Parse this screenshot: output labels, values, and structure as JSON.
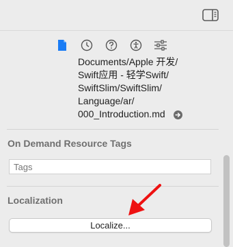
{
  "inspector": {
    "tabs": [
      {
        "icon": "file-icon",
        "active": true
      },
      {
        "icon": "history-clock-icon",
        "active": false
      },
      {
        "icon": "quick-help-icon",
        "active": false
      },
      {
        "icon": "accessibility-icon",
        "active": false
      },
      {
        "icon": "attributes-sliders-icon",
        "active": false
      }
    ],
    "path_lines": [
      "Documents/Apple 开发/",
      "Swift应用 - 轻学Swift/",
      "SwiftSlim/SwiftSlim/",
      "Language/ar/",
      "000_Introduction.md"
    ],
    "on_demand": {
      "title": "On Demand Resource Tags",
      "tags_placeholder": "Tags"
    },
    "localization": {
      "title": "Localization",
      "button_label": "Localize..."
    }
  },
  "colors": {
    "accent": "#1a7cf5",
    "annotation_arrow": "#ee1111",
    "section_title": "#6f6f6f",
    "background": "#ececec"
  }
}
